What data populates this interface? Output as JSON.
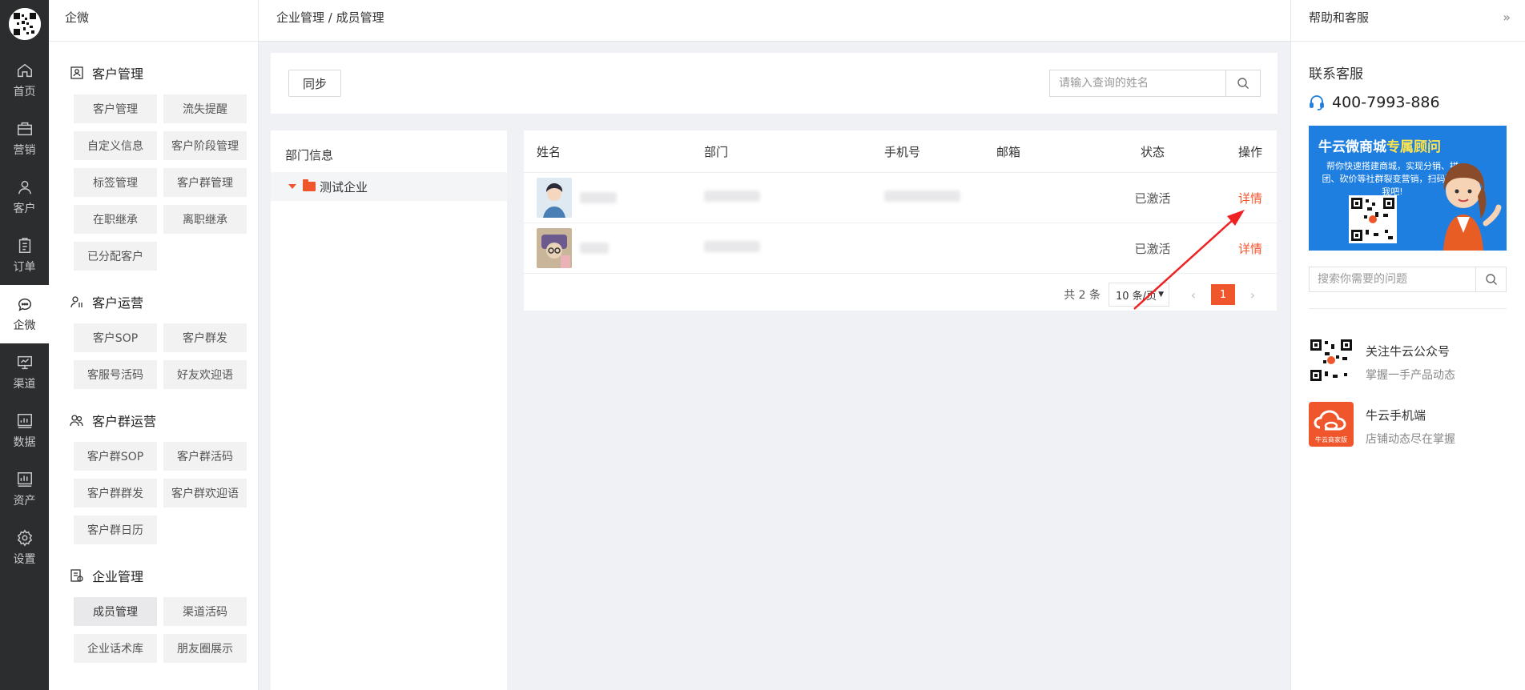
{
  "rail": {
    "items": [
      {
        "label": "首页",
        "icon": "home-icon"
      },
      {
        "label": "营销",
        "icon": "briefcase-icon"
      },
      {
        "label": "客户",
        "icon": "user-icon"
      },
      {
        "label": "订单",
        "icon": "clipboard-icon"
      },
      {
        "label": "企微",
        "icon": "chat-icon",
        "active": true
      },
      {
        "label": "渠道",
        "icon": "monitor-icon"
      },
      {
        "label": "数据",
        "icon": "bar-chart-icon"
      },
      {
        "label": "资产",
        "icon": "asset-chart-icon"
      },
      {
        "label": "设置",
        "icon": "gear-icon"
      }
    ]
  },
  "sidenav": {
    "title": "企微",
    "groups": [
      {
        "title": "客户管理",
        "items": [
          "客户管理",
          "流失提醒",
          "自定义信息",
          "客户阶段管理",
          "标签管理",
          "客户群管理",
          "在职继承",
          "离职继承",
          "已分配客户"
        ]
      },
      {
        "title": "客户运营",
        "items": [
          "客户SOP",
          "客户群发",
          "客服号活码",
          "好友欢迎语"
        ]
      },
      {
        "title": "客户群运营",
        "items": [
          "客户群SOP",
          "客户群活码",
          "客户群群发",
          "客户群欢迎语",
          "客户群日历"
        ]
      },
      {
        "title": "企业管理",
        "items": [
          "成员管理",
          "渠道活码",
          "企业话术库",
          "朋友圈展示"
        ],
        "active": "成员管理"
      }
    ]
  },
  "header": {
    "breadcrumb": "企业管理 / 成员管理"
  },
  "toolbar": {
    "sync_label": "同步",
    "search_placeholder": "请输入查询的姓名"
  },
  "dept": {
    "title": "部门信息",
    "root": "测试企业"
  },
  "table": {
    "columns": [
      "姓名",
      "部门",
      "手机号",
      "邮箱",
      "状态",
      "操作"
    ],
    "rows": [
      {
        "status": "已激活",
        "action": "详情"
      },
      {
        "status": "已激活",
        "action": "详情"
      }
    ]
  },
  "pager": {
    "total": "共 2 条",
    "size": "10 条/页",
    "current": "1"
  },
  "help": {
    "title": "帮助和客服",
    "contact_title": "联系客服",
    "phone": "400-7993-886",
    "banner_title_a": "牛云微商城",
    "banner_title_b": "专属顾问",
    "banner_text": "帮你快速搭建商城，实现分销、拼团、砍价等社群裂变营销，扫码联系我吧!",
    "search_placeholder": "搜索你需要的问题",
    "promos": [
      {
        "title": "关注牛云公众号",
        "subtitle": "掌握一手产品动态"
      },
      {
        "title": "牛云手机端",
        "subtitle": "店铺动态尽在掌握"
      }
    ],
    "app_caption": "牛云商家版"
  },
  "colors": {
    "accent": "#f0562c",
    "rail": "#2b2d2f",
    "banner": "#1f7fe0"
  }
}
